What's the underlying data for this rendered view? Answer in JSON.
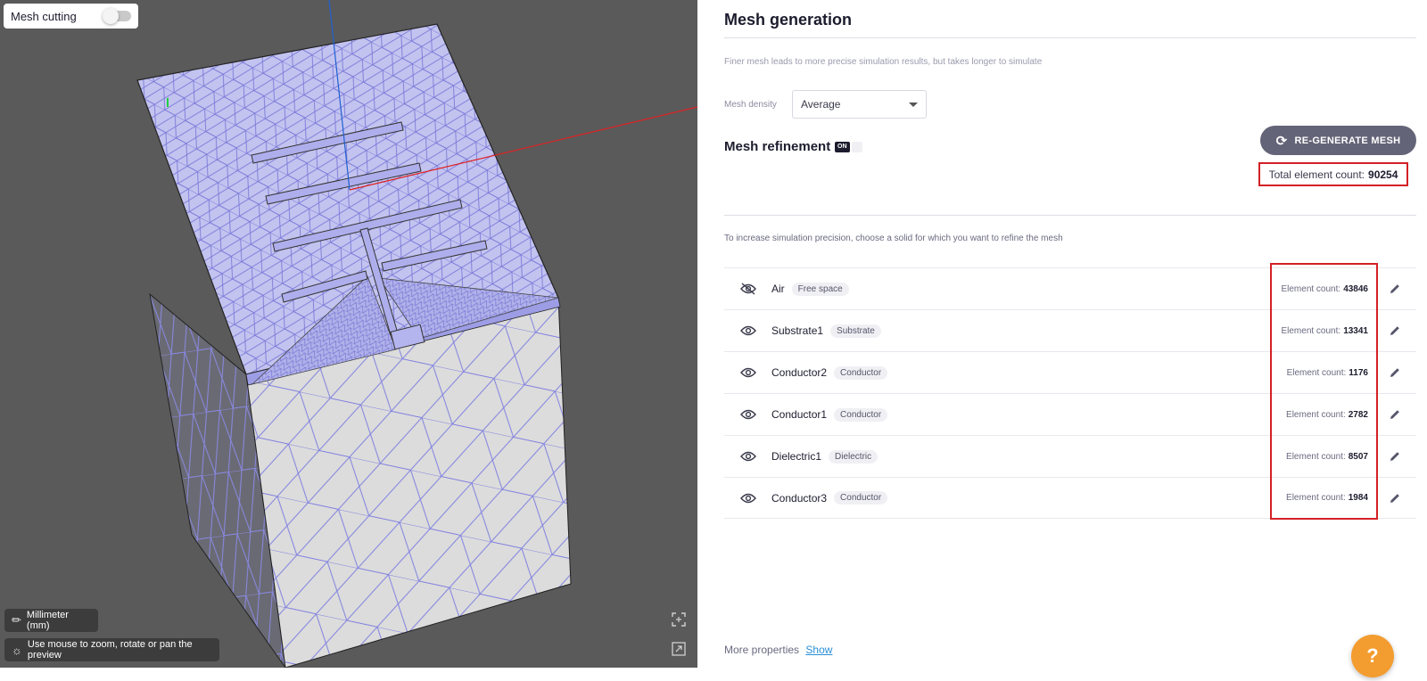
{
  "viewport": {
    "mesh_cutting_label": "Mesh cutting",
    "mesh_cutting_on": false,
    "unit_label": "Millimeter (mm)",
    "hint_label": "Use mouse to zoom, rotate or pan the preview",
    "colors": {
      "background": "#5a5a5a",
      "mesh_top": "#c3c3f0",
      "mesh_line": "#7a7ad8",
      "mesh_side": "#dcdcdc",
      "axis_x": "#e02020",
      "axis_y": "#2060d0"
    }
  },
  "panel": {
    "title": "Mesh generation",
    "subtitle": "Finer mesh leads to more precise simulation results, but takes longer to simulate",
    "density_label": "Mesh density",
    "density_value": "Average",
    "refinement_title": "Mesh refinement",
    "refinement_switch": "ON",
    "regenerate_label": "RE-GENERATE MESH",
    "total_label": "Total element count:",
    "total_value": "90254",
    "instructions": "To increase simulation precision, choose a solid for which you want to refine the mesh",
    "count_label": "Element count:",
    "solids": [
      {
        "name": "Air",
        "tag": "Free space",
        "count": "43846",
        "visible": false
      },
      {
        "name": "Substrate1",
        "tag": "Substrate",
        "count": "13341",
        "visible": true
      },
      {
        "name": "Conductor2",
        "tag": "Conductor",
        "count": "1176",
        "visible": true
      },
      {
        "name": "Conductor1",
        "tag": "Conductor",
        "count": "2782",
        "visible": true
      },
      {
        "name": "Dielectric1",
        "tag": "Dielectric",
        "count": "8507",
        "visible": true
      },
      {
        "name": "Conductor3",
        "tag": "Conductor",
        "count": "1984",
        "visible": true
      }
    ],
    "more_label": "More properties",
    "show_label": "Show",
    "accent_color": "#d42026",
    "help_color": "#f39c2f"
  }
}
